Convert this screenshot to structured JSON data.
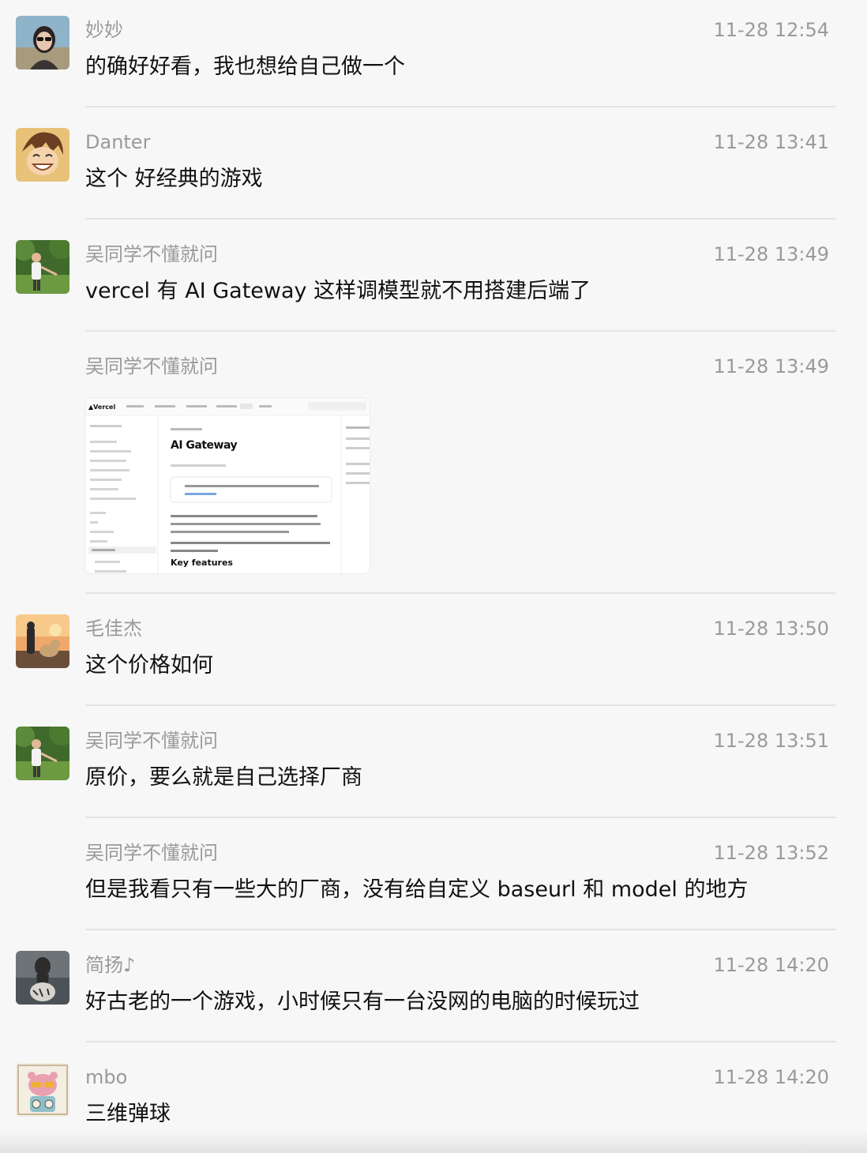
{
  "messages": [
    {
      "name": "妙妙",
      "time": "11-28 12:54",
      "text": "的确好好看，我也想给自己做一个",
      "avatar": "woman-sunglasses-avatar"
    },
    {
      "name": "Danter",
      "time": "11-28 13:41",
      "text": "这个 好经典的游戏",
      "avatar": "anime-boy-avatar"
    },
    {
      "name": "吴同学不懂就问",
      "time": "11-28 13:49",
      "text": "vercel 有 AI Gateway  这样调模型就不用搭建后端了",
      "avatar": "man-in-field-avatar"
    },
    {
      "name": "吴同学不懂就问",
      "time": "11-28 13:49",
      "image": {
        "brand": "▲Vercel",
        "title": "AI Gateway",
        "subtitle": "Key features"
      }
    },
    {
      "name": "毛佳杰",
      "time": "11-28 13:50",
      "text": "这个价格如何",
      "avatar": "boy-with-dog-avatar"
    },
    {
      "name": "吴同学不懂就问",
      "time": "11-28 13:51",
      "text": "原价，要么就是自己选择厂商",
      "avatar": "man-in-field-avatar"
    },
    {
      "name": "吴同学不懂就问",
      "time": "11-28 13:52",
      "text": "但是我看只有一些大的厂商，没有给自定义 baseurl 和 model 的地方"
    },
    {
      "name": "简扬♪",
      "time": "11-28 14:20",
      "text": "好古老的一个游戏，小时候只有一台没网的电脑的时候玩过",
      "avatar": "cat-tiger-avatar"
    },
    {
      "name": "mbo",
      "time": "11-28 14:20",
      "text": "三维弹球",
      "avatar": "cartoon-bear-avatar"
    }
  ]
}
